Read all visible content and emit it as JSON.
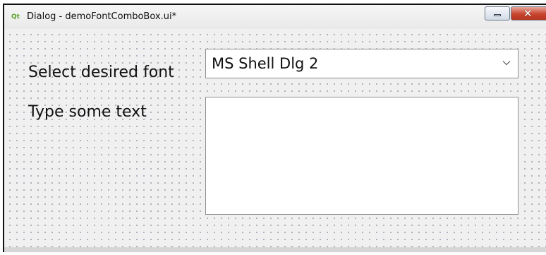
{
  "window": {
    "title": "Dialog - demoFontComboBox.ui*",
    "app_icon": "qt-icon",
    "app_icon_glyph": "Qt",
    "minimize_icon": "minimize-icon",
    "close_icon": "close-icon",
    "close_glyph": "✕"
  },
  "form": {
    "font_label": "Select desired font",
    "font_combo": {
      "selected": "MS Shell Dlg 2",
      "arrow_icon": "chevron-down-icon"
    },
    "text_label": "Type some text",
    "text_input": {
      "value": "",
      "placeholder": ""
    }
  },
  "colors": {
    "close_button": "#c7452f",
    "client_background": "#f0f0f0",
    "grid_dots": "#9aa2ad"
  }
}
